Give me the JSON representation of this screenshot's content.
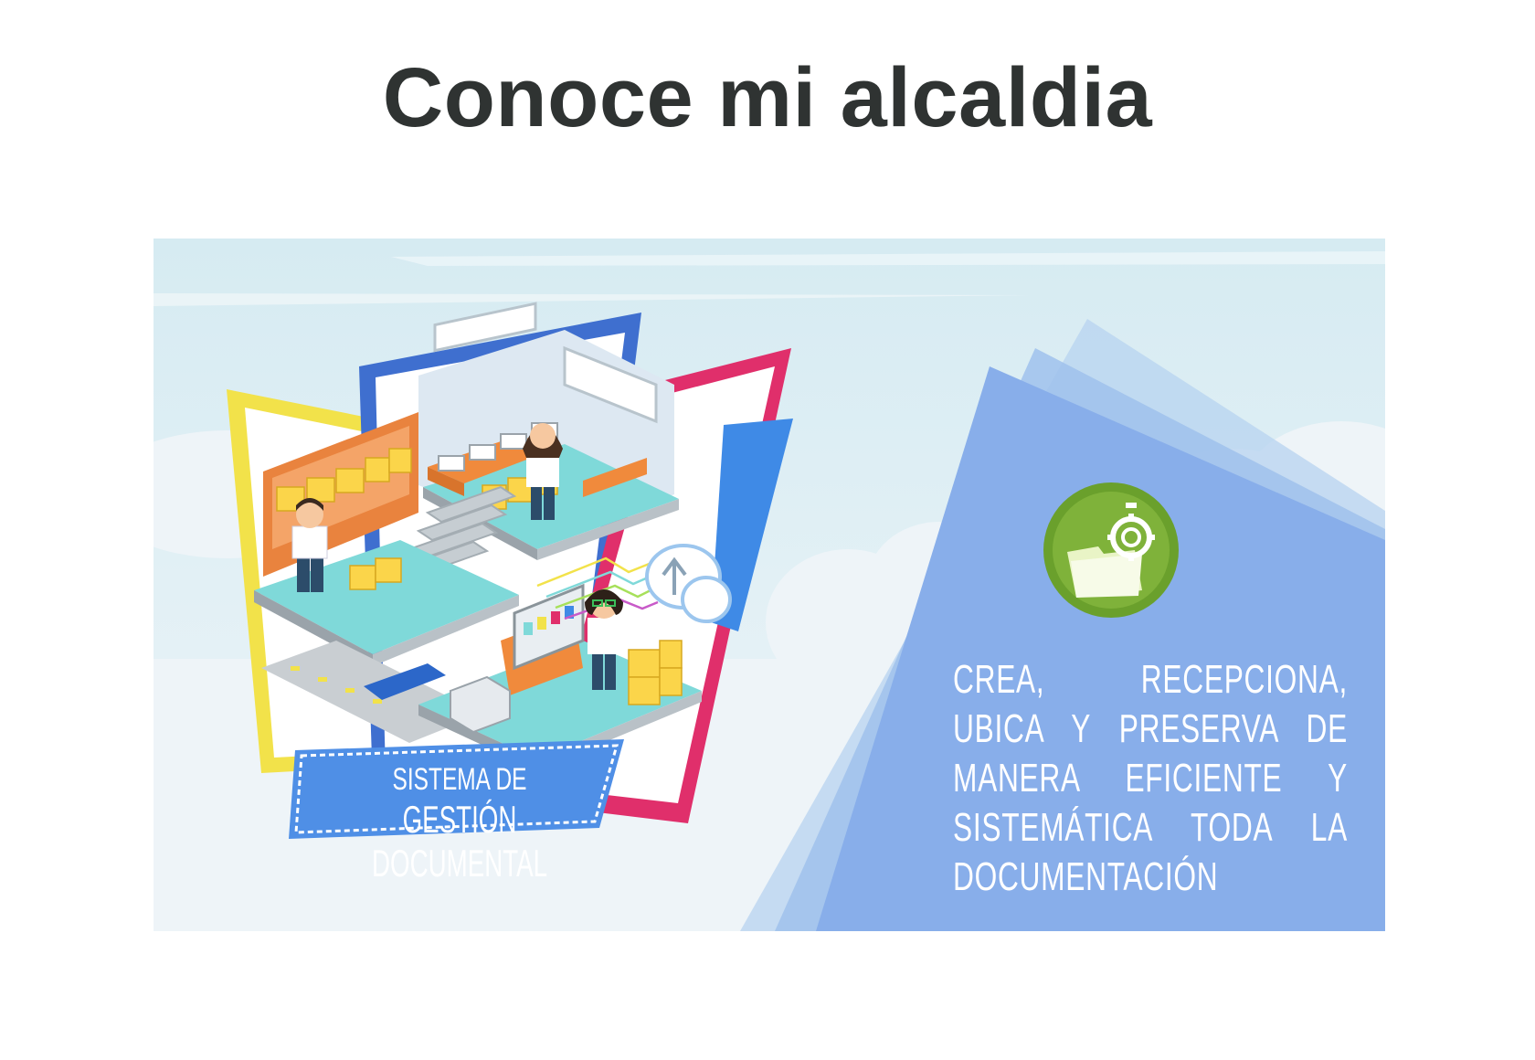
{
  "page": {
    "title": "Conoce mi alcaldia"
  },
  "banner": {
    "badge_line1": "SISTEMA DE",
    "badge_line2": "GESTIÓN DOCUMENTAL",
    "description": "CREA, RECEPCIONA, UBICA Y PRESERVA DE MANERA EFICIENTE Y SISTEMÁTICA TODA LA DOCUMENTACIÓN",
    "icon": "folder-gear-stopwatch-icon",
    "colors": {
      "sky": "#d4e9f0",
      "panel_blue": "#8aaeea",
      "badge_blue": "#4f8fe6",
      "icon_green": "#7fb23a",
      "frame_yellow": "#f2e24a",
      "frame_pink": "#e02f6b",
      "frame_blue": "#3f6fcf",
      "floor_teal": "#7fd9d9"
    }
  }
}
